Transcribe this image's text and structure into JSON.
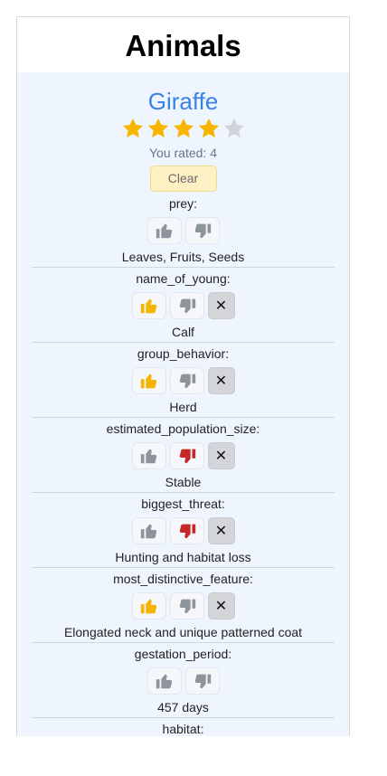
{
  "page": {
    "title": "Animals"
  },
  "animal": {
    "name": "Giraffe",
    "rating": 4,
    "max_rating": 5,
    "rated_text": "You rated: 4",
    "clear_label": "Clear"
  },
  "colors": {
    "accent": "#3b82e6",
    "star_on": "#f7b500",
    "star_off": "#d1d5db",
    "thumb_up_active": "#f4b400",
    "thumb_down_active": "#c62828",
    "thumb_inactive": "#8e949c"
  },
  "clear_icon_glyph": "✕",
  "properties": [
    {
      "label": "prey:",
      "value": "Leaves, Fruits, Seeds",
      "vote": "none"
    },
    {
      "label": "name_of_young:",
      "value": "Calf",
      "vote": "up"
    },
    {
      "label": "group_behavior:",
      "value": "Herd",
      "vote": "up"
    },
    {
      "label": "estimated_population_size:",
      "value": "Stable",
      "vote": "down"
    },
    {
      "label": "biggest_threat:",
      "value": "Hunting and habitat loss",
      "vote": "down"
    },
    {
      "label": "most_distinctive_feature:",
      "value": "Elongated neck and unique patterned coat",
      "vote": "up"
    },
    {
      "label": "gestation_period:",
      "value": "457 days",
      "vote": "none"
    },
    {
      "label": "habitat:",
      "value": "",
      "vote": "none"
    }
  ],
  "icons": {
    "star": "star-icon",
    "thumb_up": "thumbs-up-icon",
    "thumb_down": "thumbs-down-icon",
    "clear": "close-icon"
  }
}
